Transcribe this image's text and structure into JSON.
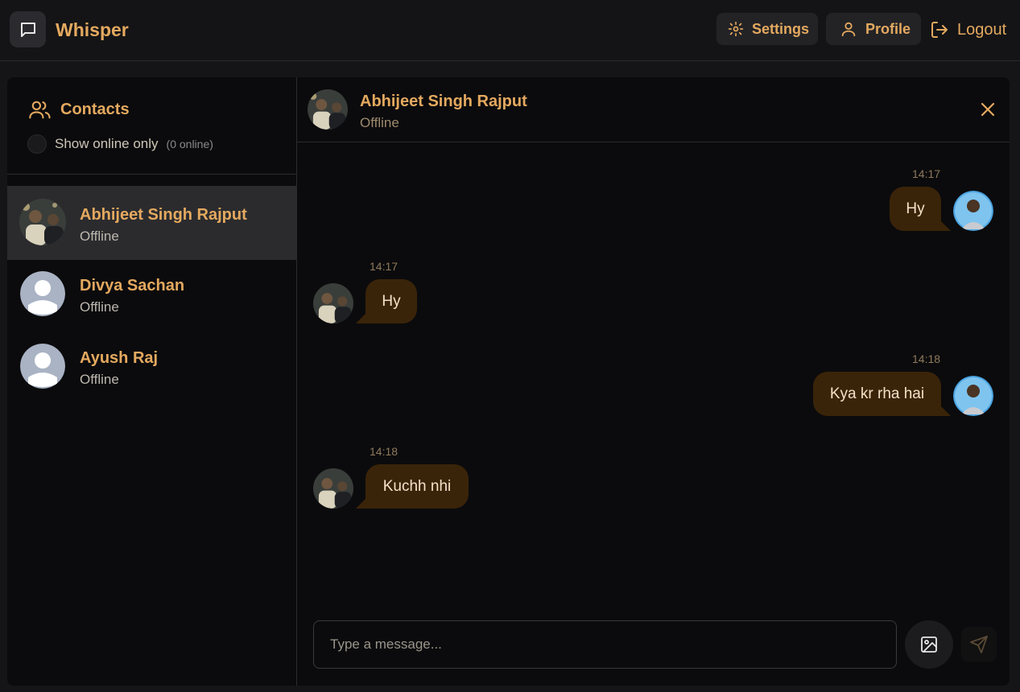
{
  "app": {
    "title": "Whisper"
  },
  "header": {
    "settings_label": "Settings",
    "profile_label": "Profile",
    "logout_label": "Logout"
  },
  "sidebar": {
    "title": "Contacts",
    "online_filter_label": "Show online only",
    "online_count": "(0 online)",
    "contacts": [
      {
        "name": "Abhijeet Singh Rajput",
        "status": "Offline",
        "avatar": "photo-avatar",
        "active": true
      },
      {
        "name": "Divya Sachan",
        "status": "Offline",
        "avatar": "default-avatar",
        "active": false
      },
      {
        "name": "Ayush Raj",
        "status": "Offline",
        "avatar": "default-avatar",
        "active": false
      }
    ]
  },
  "chat": {
    "contact_name": "Abhijeet Singh Rajput",
    "contact_status": "Offline",
    "messages": [
      {
        "direction": "outgoing",
        "time": "14:17",
        "text": "Hy"
      },
      {
        "direction": "incoming",
        "time": "14:17",
        "text": "Hy"
      },
      {
        "direction": "outgoing",
        "time": "14:18",
        "text": "Kya kr rha hai"
      },
      {
        "direction": "incoming",
        "time": "14:18",
        "text": "Kuchh nhi"
      }
    ],
    "composer": {
      "placeholder": "Type a message..."
    }
  },
  "colors": {
    "accent": "#e4a95f",
    "bubble": "#3a2409",
    "background": "#0b0b0d"
  }
}
